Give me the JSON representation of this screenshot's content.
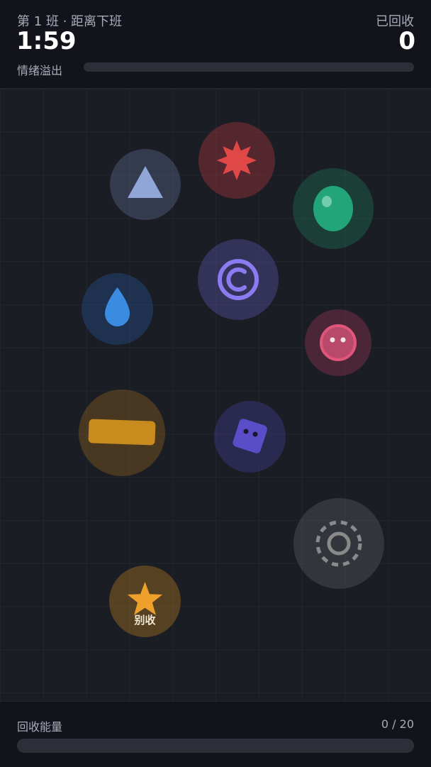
{
  "header": {
    "shift_label": "第 1 班 · 距离下班",
    "timer": "1:59",
    "collected_label": "已回收",
    "collected_count": "0",
    "overflow_label": "情绪溢出",
    "overflow_level": 0
  },
  "items": [
    {
      "id": "triangle",
      "icon": "triangle-icon",
      "color": "#8fa6d6",
      "label": ""
    },
    {
      "id": "starburst",
      "icon": "starburst-icon",
      "color": "#e04848",
      "label": ""
    },
    {
      "id": "green-blob",
      "icon": "green-blob-icon",
      "color": "#22a679",
      "label": ""
    },
    {
      "id": "swirl",
      "icon": "swirl-icon",
      "color": "#8a7cf0",
      "label": ""
    },
    {
      "id": "droplet",
      "icon": "droplet-icon",
      "color": "#3b8be0",
      "label": ""
    },
    {
      "id": "pink-face",
      "icon": "pink-face-icon",
      "color": "#e0567a",
      "label": ""
    },
    {
      "id": "orange-bar",
      "icon": "orange-bar-icon",
      "color": "#c98a1e",
      "label": ""
    },
    {
      "id": "purple-cube",
      "icon": "purple-cube-icon",
      "color": "#5b4cc8",
      "label": ""
    },
    {
      "id": "dashed-ring",
      "icon": "dashed-ring-icon",
      "color": "#9a9a9a",
      "label": ""
    },
    {
      "id": "gold-star",
      "icon": "star-icon",
      "color": "#eda02a",
      "label": "别收"
    }
  ],
  "footer": {
    "energy_label": "回收能量",
    "energy_value": "0 / 20",
    "energy_level": 0
  }
}
